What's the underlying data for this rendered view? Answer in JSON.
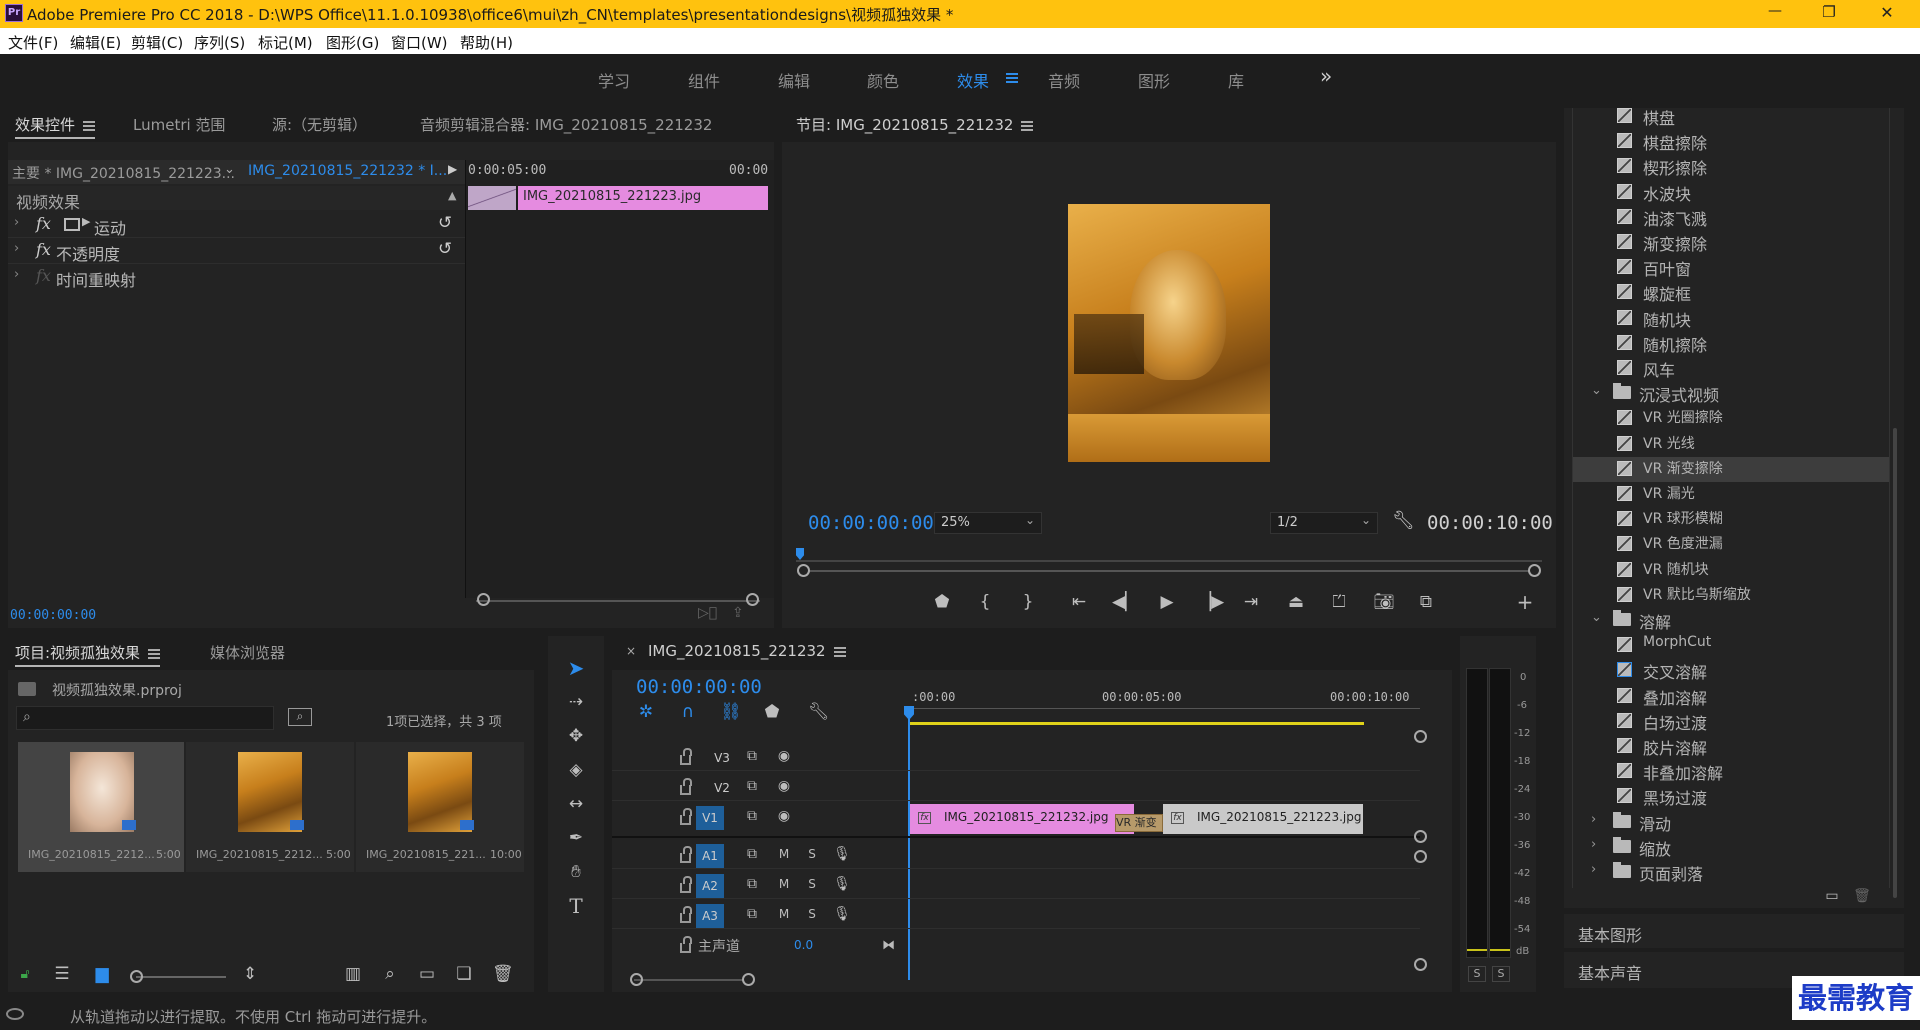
{
  "titlebar": {
    "title": "Adobe Premiere Pro CC 2018 - D:\\WPS Office\\11.1.0.10938\\office6\\mui\\zh_CN\\templates\\presentationdesigns\\视频孤独效果 *",
    "app_icon": "Pr",
    "minimize": "—",
    "maximize": "❐",
    "close": "✕"
  },
  "menubar": [
    "文件(F)",
    "编辑(E)",
    "剪辑(C)",
    "序列(S)",
    "标记(M)",
    "图形(G)",
    "窗口(W)",
    "帮助(H)"
  ],
  "workspaces": [
    "学习",
    "组件",
    "编辑",
    "颜色",
    "效果",
    "音频",
    "图形",
    "库"
  ],
  "workspace_active": "效果",
  "workspace_more": "»",
  "effect_controls": {
    "tabs": [
      "效果控件",
      "Lumetri 范围",
      "源:（无剪辑）",
      "音频剪辑混合器: IMG_20210815_221232"
    ],
    "master_label": "主要 * IMG_20210815_221223...",
    "sequence_label": "IMG_20210815_221232 * I...",
    "ruler_start": "0:00:05:00",
    "ruler_end": "00:00",
    "clip_name": "IMG_20210815_221223.jpg",
    "section": "视频效果",
    "effects": [
      {
        "fx": "fx",
        "name": "运动"
      },
      {
        "fx": "fx",
        "name": "不透明度"
      },
      {
        "fx": "fx",
        "name": "时间重映射"
      }
    ],
    "timecode": "00:00:00:00"
  },
  "program": {
    "title": "节目: IMG_20210815_221232",
    "timecode": "00:00:00:00",
    "zoom": "25%",
    "resolution": "1/2",
    "duration": "00:00:10:00"
  },
  "project": {
    "tabs": [
      "项目:视频孤独效果",
      "媒体浏览器"
    ],
    "file": "视频孤独效果.prproj",
    "selection": "1项已选择，共 3 项",
    "items": [
      {
        "name": "IMG_20210815_2212...",
        "dur": "5:00"
      },
      {
        "name": "IMG_20210815_2212...",
        "dur": "5:00"
      },
      {
        "name": "IMG_20210815_221...",
        "dur": "10:00"
      }
    ]
  },
  "timeline": {
    "title": "IMG_20210815_221232",
    "timecode": "00:00:00:00",
    "ruler": [
      ":00:00",
      "00:00:05:00",
      "00:00:10:00"
    ],
    "video_tracks": [
      "V3",
      "V2",
      "V1"
    ],
    "audio_tracks": [
      "A1",
      "A2",
      "A3"
    ],
    "master_label": "主声道",
    "master_value": "0.0",
    "clip1": "IMG_20210815_221232.jpg",
    "clip2": "IMG_20210815_221223.jpg",
    "transition": "VR 渐变",
    "m": "M",
    "s": "S"
  },
  "meter": {
    "ticks": [
      "0",
      "-6",
      "-12",
      "-18",
      "-24",
      "-30",
      "-36",
      "-42",
      "-48",
      "-54",
      "dB"
    ],
    "solo": [
      "S",
      "S"
    ]
  },
  "effects_panel": {
    "rows": [
      {
        "type": "item",
        "label": "棋盘"
      },
      {
        "type": "item",
        "label": "棋盘擦除"
      },
      {
        "type": "item",
        "label": "楔形擦除"
      },
      {
        "type": "item",
        "label": "水波块"
      },
      {
        "type": "item",
        "label": "油漆飞溅"
      },
      {
        "type": "item",
        "label": "渐变擦除"
      },
      {
        "type": "item",
        "label": "百叶窗"
      },
      {
        "type": "item",
        "label": "螺旋框"
      },
      {
        "type": "item",
        "label": "随机块"
      },
      {
        "type": "item",
        "label": "随机擦除"
      },
      {
        "type": "item",
        "label": "风车"
      },
      {
        "type": "folder-open",
        "label": "沉浸式视频"
      },
      {
        "type": "item",
        "label": "VR 光圈擦除"
      },
      {
        "type": "item",
        "label": "VR 光线"
      },
      {
        "type": "item-selected",
        "label": "VR 渐变擦除"
      },
      {
        "type": "item",
        "label": "VR 漏光"
      },
      {
        "type": "item",
        "label": "VR 球形模糊"
      },
      {
        "type": "item",
        "label": "VR 色度泄漏"
      },
      {
        "type": "item",
        "label": "VR 随机块"
      },
      {
        "type": "item",
        "label": "VR 默比乌斯缩放"
      },
      {
        "type": "folder-open",
        "label": "溶解"
      },
      {
        "type": "item",
        "label": "MorphCut"
      },
      {
        "type": "item",
        "label": "交叉溶解"
      },
      {
        "type": "item",
        "label": "叠加溶解"
      },
      {
        "type": "item",
        "label": "白场过渡"
      },
      {
        "type": "item",
        "label": "胶片溶解"
      },
      {
        "type": "item",
        "label": "非叠加溶解"
      },
      {
        "type": "item",
        "label": "黑场过渡"
      },
      {
        "type": "folder",
        "label": "滑动"
      },
      {
        "type": "folder",
        "label": "缩放"
      },
      {
        "type": "folder",
        "label": "页面剥落"
      }
    ],
    "sections": [
      "基本图形",
      "基本声音"
    ]
  },
  "statusbar": "从轨道拖动以进行提取。不使用 Ctrl 拖动可进行提升。",
  "watermark": "最需教育",
  "colors": {
    "accent": "#2d8ceb",
    "clip_pink": "#e58be0",
    "clip_gray": "#c9c9c9",
    "titlebar": "#ffc20e"
  }
}
